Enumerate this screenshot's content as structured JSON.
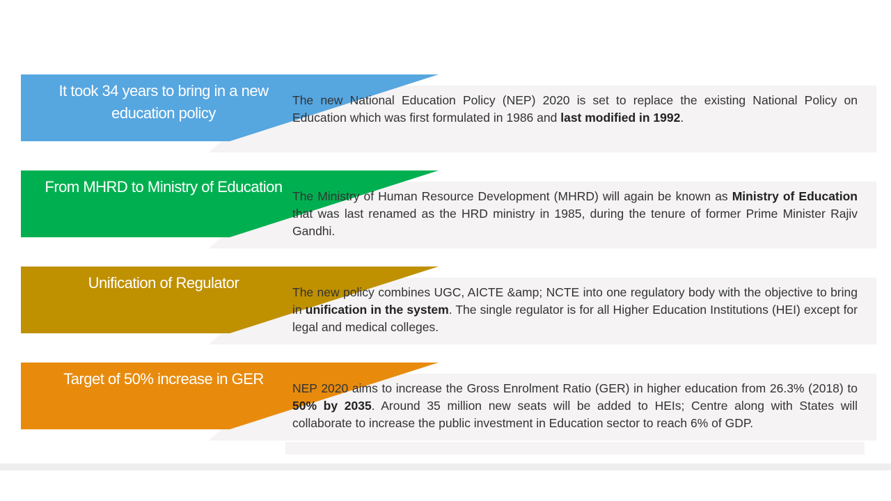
{
  "colors": {
    "row1": "#56a6e0",
    "row2": "#00b050",
    "row3": "#bf9000",
    "row4": "#e88b0d",
    "panel": "#f5f3f4"
  },
  "rows": [
    {
      "title": "It took 34 years to bring in a new education policy",
      "desc": [
        {
          "text": "The new National Education Policy (NEP) 2020 is set to replace the existing National Policy on Education which was first formulated in 1986 and "
        },
        {
          "text": "last modified in 1992",
          "bold": true
        },
        {
          "text": "."
        }
      ]
    },
    {
      "title": "From MHRD to Ministry of Education",
      "desc": [
        {
          "text": "The Ministry of Human Resource Development (MHRD) will again be known as "
        },
        {
          "text": "Ministry of Education",
          "bold": true
        },
        {
          "text": " that was last renamed as the HRD ministry in 1985, during the tenure of former Prime Minister Rajiv Gandhi."
        }
      ]
    },
    {
      "title": "Unification of Regulator",
      "desc": [
        {
          "text": "The new policy combines UGC, AICTE &amp; NCTE into one regulatory body with the objective to bring in "
        },
        {
          "text": "unification in the system",
          "bold": true
        },
        {
          "text": ". The single regulator is for all Higher Education Institutions (HEI) except for legal and medical colleges."
        }
      ]
    },
    {
      "title": "Target of 50%  increase in GER",
      "desc": [
        {
          "text": "NEP 2020 aims to increase the Gross Enrolment Ratio (GER) in higher education from 26.3% (2018) to "
        },
        {
          "text": "50% by 2035",
          "bold": true
        },
        {
          "text": ". Around 35 million new seats will be added to HEIs; Centre along with States will collaborate to increase the public investment in Education sector to reach 6% of GDP."
        }
      ]
    }
  ]
}
